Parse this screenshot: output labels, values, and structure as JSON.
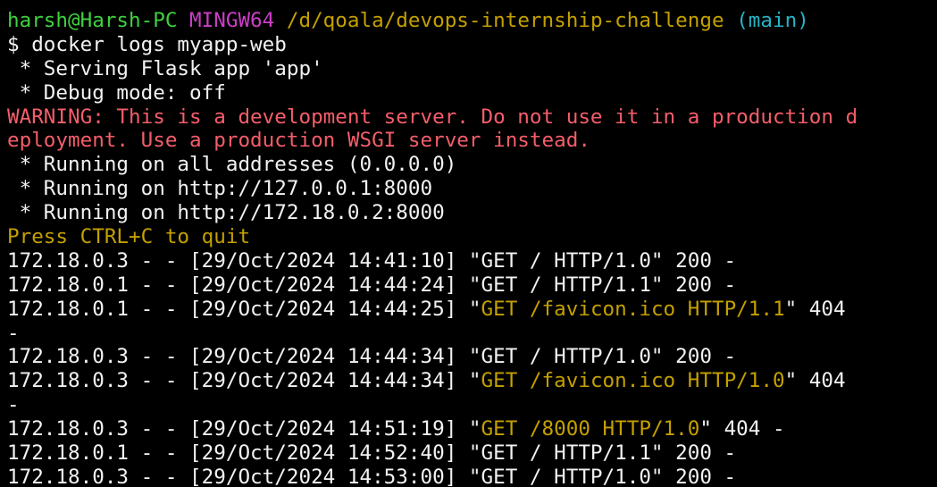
{
  "colors": {
    "background": "#000000",
    "default": "#f2f2f2",
    "user": "#3fd13f",
    "msystem": "#cc3ec7",
    "path": "#c4a000",
    "branch": "#26b3c4",
    "warning": "#f45e6a",
    "notice": "#c4a000",
    "request": "#c4a000"
  },
  "lines": [
    {
      "segments": [
        {
          "text": "harsh@Harsh-PC",
          "color": "user"
        },
        {
          "text": " ",
          "color": "default"
        },
        {
          "text": "MINGW64",
          "color": "msystem"
        },
        {
          "text": " ",
          "color": "default"
        },
        {
          "text": "/d/qoala/devops-internship-challenge",
          "color": "path"
        },
        {
          "text": " ",
          "color": "default"
        },
        {
          "text": "(main)",
          "color": "branch"
        }
      ]
    },
    {
      "segments": [
        {
          "text": "$ docker logs myapp-web",
          "color": "default"
        }
      ]
    },
    {
      "segments": [
        {
          "text": " * Serving Flask app 'app'",
          "color": "default"
        }
      ]
    },
    {
      "segments": [
        {
          "text": " * Debug mode: off",
          "color": "default"
        }
      ]
    },
    {
      "segments": [
        {
          "text": "WARNING: This is a development server. Do not use it in a production d",
          "color": "warning"
        }
      ]
    },
    {
      "segments": [
        {
          "text": "eployment. Use a production WSGI server instead.",
          "color": "warning"
        }
      ]
    },
    {
      "segments": [
        {
          "text": " * Running on all addresses (0.0.0.0)",
          "color": "default"
        }
      ]
    },
    {
      "segments": [
        {
          "text": " * Running on http://127.0.0.1:8000",
          "color": "default"
        }
      ]
    },
    {
      "segments": [
        {
          "text": " * Running on http://172.18.0.2:8000",
          "color": "default"
        }
      ]
    },
    {
      "segments": [
        {
          "text": "Press CTRL+C to quit",
          "color": "notice"
        }
      ]
    },
    {
      "segments": [
        {
          "text": "172.18.0.3 - - [29/Oct/2024 14:41:10] \"GET / HTTP/1.0\" 200 -",
          "color": "default"
        }
      ]
    },
    {
      "segments": [
        {
          "text": "172.18.0.1 - - [29/Oct/2024 14:44:24] \"GET / HTTP/1.1\" 200 -",
          "color": "default"
        }
      ]
    },
    {
      "segments": [
        {
          "text": "172.18.0.1 - - [29/Oct/2024 14:44:25] \"",
          "color": "default"
        },
        {
          "text": "GET /favicon.ico HTTP/1.1",
          "color": "request"
        },
        {
          "text": "\" 404",
          "color": "default"
        }
      ]
    },
    {
      "segments": [
        {
          "text": "-",
          "color": "default"
        }
      ]
    },
    {
      "segments": [
        {
          "text": "172.18.0.3 - - [29/Oct/2024 14:44:34] \"GET / HTTP/1.0\" 200 -",
          "color": "default"
        }
      ]
    },
    {
      "segments": [
        {
          "text": "172.18.0.3 - - [29/Oct/2024 14:44:34] \"",
          "color": "default"
        },
        {
          "text": "GET /favicon.ico HTTP/1.0",
          "color": "request"
        },
        {
          "text": "\" 404",
          "color": "default"
        }
      ]
    },
    {
      "segments": [
        {
          "text": "-",
          "color": "default"
        }
      ]
    },
    {
      "segments": [
        {
          "text": "172.18.0.3 - - [29/Oct/2024 14:51:19] \"",
          "color": "default"
        },
        {
          "text": "GET /8000 HTTP/1.0",
          "color": "request"
        },
        {
          "text": "\" 404 -",
          "color": "default"
        }
      ]
    },
    {
      "segments": [
        {
          "text": "172.18.0.1 - - [29/Oct/2024 14:52:40] \"GET / HTTP/1.1\" 200 -",
          "color": "default"
        }
      ]
    },
    {
      "segments": [
        {
          "text": "172.18.0.3 - - [29/Oct/2024 14:53:00] \"GET / HTTP/1.0\" 200 -",
          "color": "default"
        }
      ]
    }
  ]
}
